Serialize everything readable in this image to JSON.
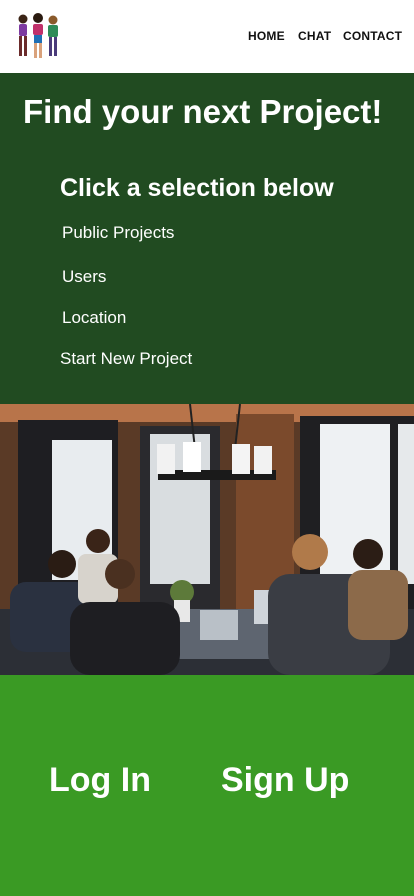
{
  "header": {
    "logo_icon": "characters-logo-icon",
    "nav": {
      "home": "HOME",
      "chat": "CHAT",
      "contact": "CONTACT"
    }
  },
  "hero": {
    "title": "Find your next Project!",
    "subtitle": "Click a selection below",
    "background": "#214b21",
    "menu": [
      "Public Projects",
      "Users",
      "Location",
      "Start New Project"
    ]
  },
  "photo": {
    "icon": "team-meeting-photo"
  },
  "footer": {
    "background": "#3a9a24",
    "login": "Log In",
    "signup": "Sign Up"
  }
}
